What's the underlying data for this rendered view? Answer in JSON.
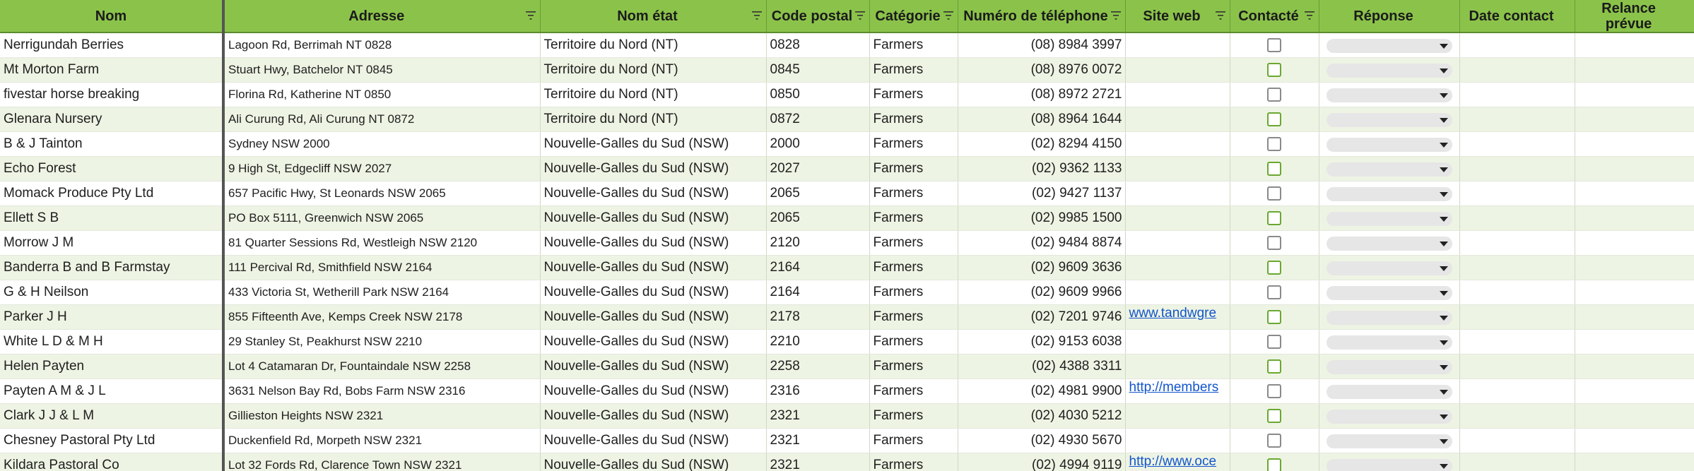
{
  "columns": [
    "Nom",
    "Adresse",
    "Nom état",
    "Code postal",
    "Catégorie",
    "Numéro de téléphone",
    "Site web",
    "Contacté",
    "Réponse",
    "Date contact",
    "Relance prévue"
  ],
  "rows": [
    {
      "nom": "Nerrigundah Berries",
      "adresse": "Lagoon Rd, Berrimah NT 0828",
      "etat": "Territoire du Nord (NT)",
      "cp": "0828",
      "cat": "Farmers",
      "tel": "(08) 8984 3997",
      "web": ""
    },
    {
      "nom": "Mt Morton Farm",
      "adresse": "Stuart Hwy, Batchelor NT 0845",
      "etat": "Territoire du Nord (NT)",
      "cp": "0845",
      "cat": "Farmers",
      "tel": "(08) 8976 0072",
      "web": ""
    },
    {
      "nom": "fivestar horse breaking",
      "adresse": "Florina Rd, Katherine NT 0850",
      "etat": "Territoire du Nord (NT)",
      "cp": "0850",
      "cat": "Farmers",
      "tel": "(08) 8972 2721",
      "web": ""
    },
    {
      "nom": "Glenara Nursery",
      "adresse": "Ali Curung Rd, Ali Curung NT 0872",
      "etat": "Territoire du Nord (NT)",
      "cp": "0872",
      "cat": "Farmers",
      "tel": "(08) 8964 1644",
      "web": ""
    },
    {
      "nom": "B & J Tainton",
      "adresse": "Sydney NSW 2000",
      "etat": "Nouvelle-Galles du Sud (NSW)",
      "cp": "2000",
      "cat": "Farmers",
      "tel": "(02) 8294 4150",
      "web": ""
    },
    {
      "nom": "Echo Forest",
      "adresse": "9 High St, Edgecliff NSW 2027",
      "etat": "Nouvelle-Galles du Sud (NSW)",
      "cp": "2027",
      "cat": "Farmers",
      "tel": "(02) 9362 1133",
      "web": ""
    },
    {
      "nom": "Momack Produce Pty Ltd",
      "adresse": "657 Pacific Hwy, St Leonards NSW 2065",
      "etat": "Nouvelle-Galles du Sud (NSW)",
      "cp": "2065",
      "cat": "Farmers",
      "tel": "(02) 9427 1137",
      "web": ""
    },
    {
      "nom": "Ellett S B",
      "adresse": "PO Box 5111, Greenwich NSW 2065",
      "etat": "Nouvelle-Galles du Sud (NSW)",
      "cp": "2065",
      "cat": "Farmers",
      "tel": "(02) 9985 1500",
      "web": ""
    },
    {
      "nom": "Morrow J M",
      "adresse": "81 Quarter Sessions Rd, Westleigh NSW 2120",
      "etat": "Nouvelle-Galles du Sud (NSW)",
      "cp": "2120",
      "cat": "Farmers",
      "tel": "(02) 9484 8874",
      "web": ""
    },
    {
      "nom": "Banderra B and B Farmstay",
      "adresse": "111 Percival Rd, Smithfield NSW 2164",
      "etat": "Nouvelle-Galles du Sud (NSW)",
      "cp": "2164",
      "cat": "Farmers",
      "tel": "(02) 9609 3636",
      "web": ""
    },
    {
      "nom": "G & H Neilson",
      "adresse": "433 Victoria St, Wetherill Park NSW 2164",
      "etat": "Nouvelle-Galles du Sud (NSW)",
      "cp": "2164",
      "cat": "Farmers",
      "tel": "(02) 9609 9966",
      "web": ""
    },
    {
      "nom": "Parker J H",
      "adresse": "855 Fifteenth Ave, Kemps Creek NSW 2178",
      "etat": "Nouvelle-Galles du Sud (NSW)",
      "cp": "2178",
      "cat": "Farmers",
      "tel": "(02) 7201 9746",
      "web": "www.tandwgre"
    },
    {
      "nom": "White L D & M H",
      "adresse": "29 Stanley St, Peakhurst NSW 2210",
      "etat": "Nouvelle-Galles du Sud (NSW)",
      "cp": "2210",
      "cat": "Farmers",
      "tel": "(02) 9153 6038",
      "web": ""
    },
    {
      "nom": "Helen Payten",
      "adresse": "Lot 4 Catamaran Dr, Fountaindale NSW 2258",
      "etat": "Nouvelle-Galles du Sud (NSW)",
      "cp": "2258",
      "cat": "Farmers",
      "tel": "(02) 4388 3311",
      "web": ""
    },
    {
      "nom": "Payten A M & J L",
      "adresse": "3631 Nelson Bay Rd, Bobs Farm NSW 2316",
      "etat": "Nouvelle-Galles du Sud (NSW)",
      "cp": "2316",
      "cat": "Farmers",
      "tel": "(02) 4981 9900",
      "web": "http://members"
    },
    {
      "nom": "Clark J J & L M",
      "adresse": "Gillieston Heights NSW 2321",
      "etat": "Nouvelle-Galles du Sud (NSW)",
      "cp": "2321",
      "cat": "Farmers",
      "tel": "(02) 4030 5212",
      "web": ""
    },
    {
      "nom": "Chesney Pastoral Pty Ltd",
      "adresse": "Duckenfield Rd, Morpeth NSW 2321",
      "etat": "Nouvelle-Galles du Sud (NSW)",
      "cp": "2321",
      "cat": "Farmers",
      "tel": "(02) 4930 5670",
      "web": ""
    },
    {
      "nom": "Kildara Pastoral Co",
      "adresse": "Lot 32 Fords Rd, Clarence Town NSW 2321",
      "etat": "Nouvelle-Galles du Sud (NSW)",
      "cp": "2321",
      "cat": "Farmers",
      "tel": "(02) 4994 9119",
      "web": "http://www.oce"
    }
  ],
  "colors": {
    "header_bg": "#8bc34a",
    "row_alt_bg": "#eef4e4",
    "link": "#1155cc"
  },
  "icons": {
    "filter": "filter-icon",
    "checkbox": "checkbox",
    "dropdown": "chevron-down-icon"
  }
}
